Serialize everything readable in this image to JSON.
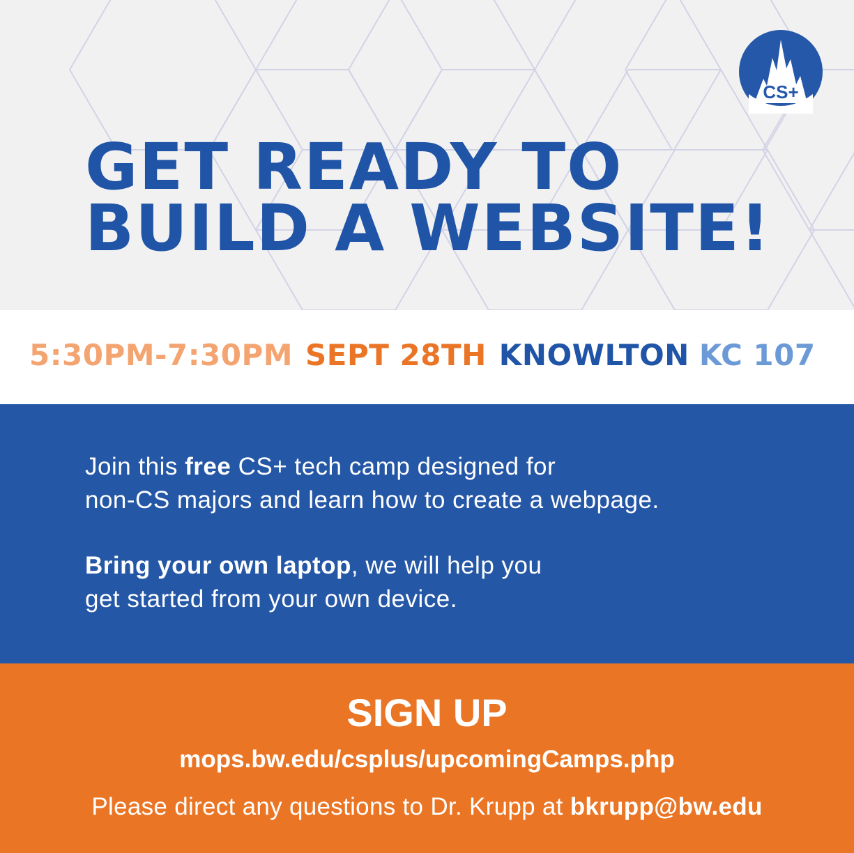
{
  "hero": {
    "logo_text": "CS+",
    "headline_line1": "GET READY TO",
    "headline_line2": "BUILD A WEBSITE!"
  },
  "event": {
    "time": "5:30PM-7:30PM",
    "date": "SEPT 28TH",
    "building": "KNOWLTON",
    "room": "KC 107"
  },
  "info": {
    "p1_prefix": "Join this ",
    "p1_bold": "free",
    "p1_line1_suffix": " CS+ tech camp designed for",
    "p1_line2": "non-CS majors and learn how to create a webpage.",
    "p2_bold": "Bring your own laptop",
    "p2_line1_suffix": ", we will help you",
    "p2_line2": "get started from your own device."
  },
  "signup": {
    "title": "SIGN UP",
    "url": "mops.bw.edu/csplus/upcomingCamps.php",
    "contact_prefix": "Please direct any questions to Dr. Krupp at ",
    "contact_email": "bkrupp@bw.edu"
  },
  "colors": {
    "hero_bg": "#f1f1f2",
    "brand_blue": "#1f54a6",
    "info_blue": "#2557a7",
    "orange": "#ea7524",
    "light_orange": "#f4a471",
    "light_blue": "#6c9ad6"
  }
}
